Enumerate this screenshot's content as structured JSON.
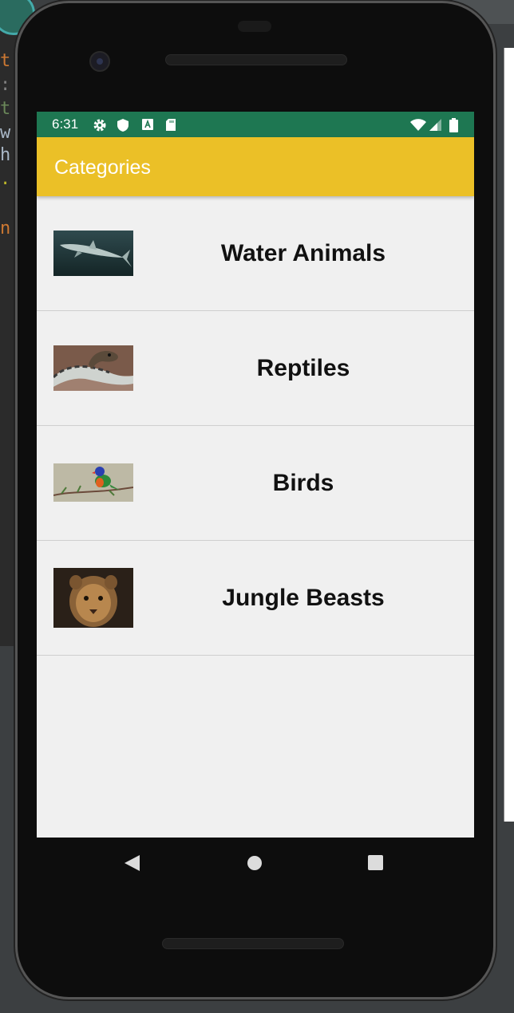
{
  "status_bar": {
    "time": "6:31",
    "left_icons": [
      "settings-icon",
      "shield-icon",
      "a-icon",
      "sd-card-icon"
    ],
    "right_icons": [
      "wifi-icon",
      "signal-icon",
      "battery-icon"
    ]
  },
  "app_bar": {
    "title": "Categories"
  },
  "categories": [
    {
      "label": "Water Animals",
      "image": "shark-image"
    },
    {
      "label": "Reptiles",
      "image": "snake-image"
    },
    {
      "label": "Birds",
      "image": "bird-image"
    },
    {
      "label": "Jungle Beasts",
      "image": "lion-cub-image"
    }
  ],
  "nav_bar": {
    "buttons": [
      "back-icon",
      "home-icon",
      "recents-icon"
    ]
  },
  "colors": {
    "status_bar": "#1e7752",
    "app_bar": "#ebc027",
    "list_background": "#f0f0f0",
    "divider": "#cfcfcf"
  }
}
